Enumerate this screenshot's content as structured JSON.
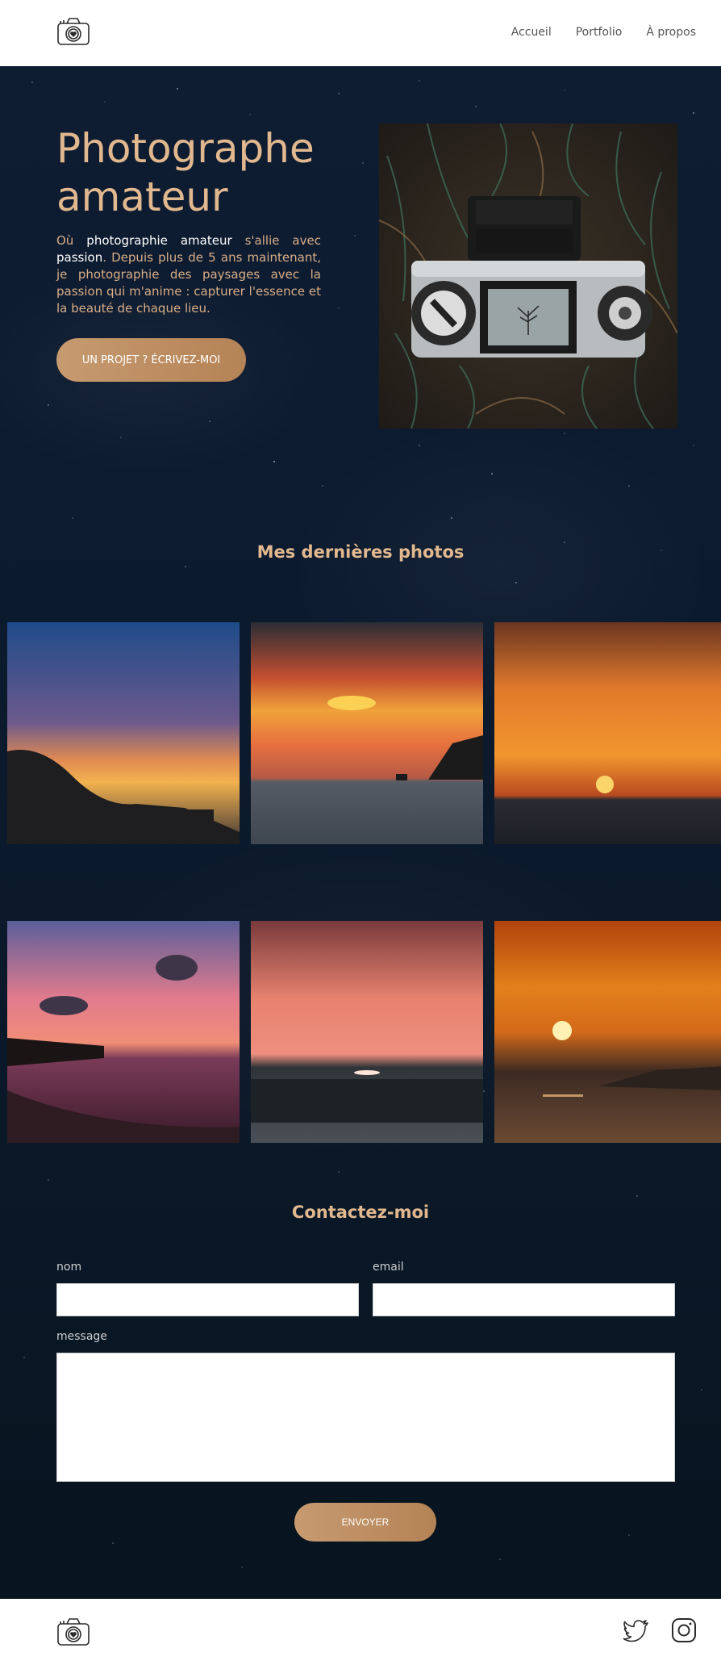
{
  "nav": {
    "items": [
      "Accueil",
      "Portfolio",
      "À propos"
    ]
  },
  "hero": {
    "title_line1": "Photographe",
    "title_line2": "amateur",
    "text": {
      "p1": "Où ",
      "strong1": "photographie amateur",
      "p2": " s'allie avec ",
      "strong2": "passion",
      "p3": ". Depuis plus de 5 ans maintenant, je photographie des paysages avec la passion qui m'anime : capturer l'essence et la beauté de chaque lieu."
    },
    "cta_label": "UN PROJET ?   ÉCRIVEZ-MOI"
  },
  "gallery": {
    "title": "Mes dernières photos"
  },
  "contact": {
    "title": "Contactez-moi",
    "name_label": "nom",
    "email_label": "email",
    "message_label": "message",
    "submit_label": "ENVOYER"
  },
  "colors": {
    "accent": "#e2b88e",
    "button": "#c49a6f",
    "background": "#0c1a2c"
  },
  "icons": {
    "logo": "camera-heart-icon",
    "social": [
      "twitter-icon",
      "instagram-icon"
    ]
  }
}
